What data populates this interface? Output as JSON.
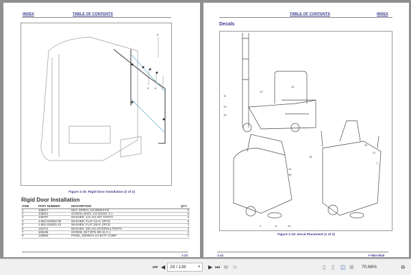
{
  "left_page": {
    "header_index": "INDEX",
    "header_toc": "TABLE OF CONTENTS",
    "figure_callouts": [
      "8",
      "5",
      "6",
      "7"
    ],
    "caption": "Figure 1-15:  Rigid Door Installation (2 of 2)",
    "title": "Rigid Door Installation",
    "table": {
      "headers": [
        "ITEM",
        "PART NUMBER",
        "DESCRIPTION",
        "QTY."
      ],
      "rows": [
        [
          "1",
          "108417",
          "NUT, SPIRAL 1/4-20HEX FG",
          "6"
        ],
        [
          "2",
          "108610",
          "SCREW, BHSC 1/4-20UNC X 1",
          "6"
        ],
        [
          "3",
          "108797",
          "WASHER, 1/4 LKG INT TOOTH",
          "6"
        ],
        [
          "4",
          "1-861-019032-06",
          "WASHER, FLAT 1/4 N. ZPCD",
          "6"
        ],
        [
          "5",
          "1-861-019032-10",
          "WASHER, FLAT 3/8 N. ZPCD",
          "2"
        ],
        [
          "6",
          "119734",
          "WASHER, 3/8 LKG INTERNALTOOTH",
          "2"
        ],
        [
          "7",
          "108336",
          "SCREW, SKT BTN 3/8-16 X 1",
          "2"
        ],
        [
          "8",
          "128858",
          "PANEL, B300M-4 LH BATT COMP",
          "1"
        ]
      ]
    },
    "page_number": "1-23"
  },
  "right_page": {
    "header_toc": "TABLE OF CONTENTS",
    "header_index": "INDEX",
    "title": "Decals",
    "figure_callouts": [
      "11",
      "19",
      "12",
      "10",
      "15",
      "22",
      "21",
      "18",
      "7",
      "24",
      "18",
      "4",
      "8",
      "23"
    ],
    "caption": "Figure 1-16:  Decal Placement (1 of 2)",
    "page_number": "1-24",
    "doc_number": "F-963-0519"
  },
  "toolbar": {
    "page_value": "28 / 136",
    "zoom": "70.68%"
  }
}
